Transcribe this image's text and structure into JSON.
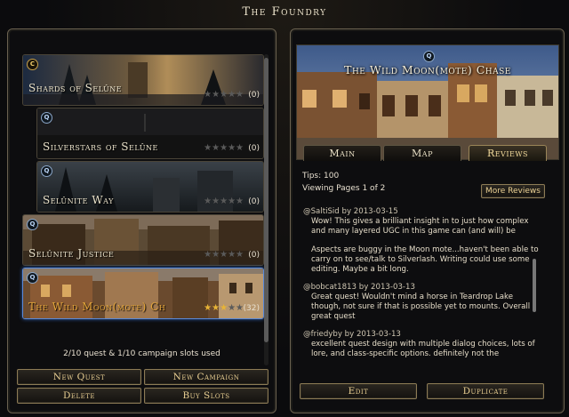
{
  "window": {
    "title": "The Foundry"
  },
  "quest_list": [
    {
      "name": "Shards of Selûne",
      "badge": "C",
      "rating": 0,
      "count": "(0)",
      "selected": false
    },
    {
      "name": "Silverstars of Selûne",
      "badge": "Q",
      "rating": 0,
      "count": "(0)",
      "selected": false
    },
    {
      "name": "Selûnite Way",
      "badge": "Q",
      "rating": 0,
      "count": "(0)",
      "selected": false
    },
    {
      "name": "Selûnite Justice",
      "badge": "Q",
      "rating": 0,
      "count": "(0)",
      "selected": false
    },
    {
      "name": "The Wild Moon(mote) Ch",
      "badge": "Q",
      "rating": 3,
      "count": "(32)",
      "selected": true
    }
  ],
  "slots_text": "2/10 quest & 1/10 campaign slots used",
  "left_buttons": {
    "new_quest": "New Quest",
    "new_campaign": "New Campaign",
    "delete": "Delete",
    "buy_slots": "Buy Slots"
  },
  "detail": {
    "badge": "Q",
    "title": "The Wild Moon(mote) Chase",
    "tabs": [
      {
        "label": "Main",
        "active": false
      },
      {
        "label": "Map",
        "active": false
      },
      {
        "label": "Reviews",
        "active": true
      }
    ],
    "tips": "Tips: 100",
    "viewing": "Viewing Pages 1 of 2",
    "more_reviews": "More Reviews",
    "reviews": [
      {
        "author": "@SaltiSid",
        "by": "by",
        "date": "2013-03-15",
        "paragraphs": [
          "Wow! This gives a brilliant insight in to just how complex and many layered UGC in this game can (and will) be",
          "Aspects are buggy in the Moon mote...haven't been able to carry on to see/talk to Silverlash. Writing could use some editing. Maybe a bit long."
        ]
      },
      {
        "author": "@bobcat1813",
        "by": "by",
        "date": "2013-03-13",
        "paragraphs": [
          "Great quest! Wouldn't mind a horse in Teardrop Lake though, not sure if that is possible yet to mounts. Overall great quest"
        ]
      },
      {
        "author": "@friedyby",
        "by": "by",
        "date": "2013-03-13",
        "paragraphs": [
          "excellent quest design with multiple dialog choices, lots of lore, and class-specific options. definitely not the"
        ]
      }
    ],
    "edit": "Edit",
    "duplicate": "Duplicate"
  }
}
